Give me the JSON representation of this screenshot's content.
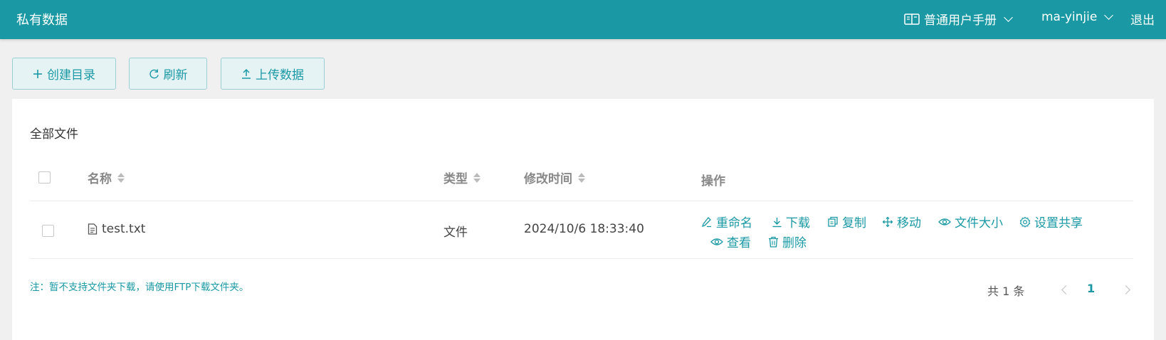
{
  "header": {
    "title": "私有数据",
    "manual_label": "普通用户手册",
    "user_name": "ma-yinjie",
    "logout_label": "退出"
  },
  "toolbar": {
    "create_dir_label": "创建目录",
    "refresh_label": "刷新",
    "upload_label": "上传数据"
  },
  "panel": {
    "section_title": "全部文件",
    "columns": {
      "name": "名称",
      "type": "类型",
      "modified": "修改时间",
      "actions": "操作"
    },
    "rows": [
      {
        "name": "test.txt",
        "type": "文件",
        "modified": "2024/10/6 18:33:40",
        "actions": {
          "rename": "重命名",
          "download": "下载",
          "copy": "复制",
          "move": "移动",
          "file_size": "文件大小",
          "share": "设置共享",
          "view": "查看",
          "delete": "删除"
        }
      }
    ],
    "note": "注：暂不支持文件夹下载，请使用FTP下载文件夹。"
  },
  "pagination": {
    "total_label": "共 1 条",
    "current_page": "1"
  },
  "colors": {
    "brand": "#1a99a5",
    "background": "#f0f0f0",
    "button_bg": "#e6f3f4"
  },
  "icons": {
    "manual": "book-icon",
    "create_dir": "plus-icon",
    "refresh": "refresh-icon",
    "upload": "upload-icon",
    "file": "file-icon",
    "rename": "edit-icon",
    "download": "download-icon",
    "copy": "copy-icon",
    "move": "move-icon",
    "file_size": "eye-icon",
    "share": "gear-icon",
    "view": "eye-icon",
    "delete": "trash-icon"
  }
}
